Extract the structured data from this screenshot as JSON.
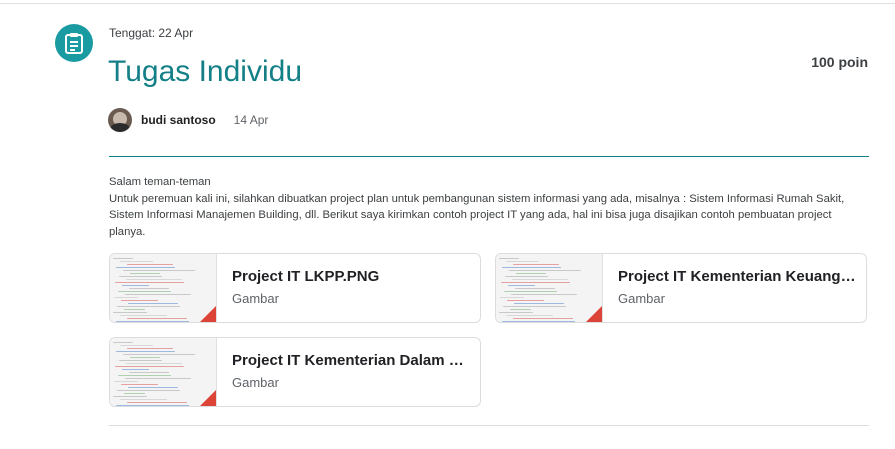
{
  "assignment": {
    "due": "Tenggat: 22 Apr",
    "title": "Tugas Individu",
    "points": "100 poin",
    "author": "budi santoso",
    "date": "14 Apr",
    "description": [
      "Salam teman-teman",
      "Untuk peremuan kali ini, silahkan dibuatkan project plan untuk pembangunan sistem informasi yang ada, misalnya : Sistem Informasi Rumah Sakit, Sistem Informasi Manajemen Building, dll. Berikut saya kirimkan contoh project IT yang ada, hal ini bisa juga disajikan contoh pembuatan project planya."
    ]
  },
  "attachments": [
    {
      "name": "Project IT LKPP.PNG",
      "type": "Gambar"
    },
    {
      "name": "Project IT Kementerian Keuangan.PNG",
      "type": "Gambar"
    },
    {
      "name": "Project IT Kementerian Dalam Negeri.PNG",
      "type": "Gambar"
    }
  ],
  "colors": {
    "accent": "#137f86",
    "icon_bg": "#1a9ba1",
    "fold": "#db4437"
  },
  "icons": {
    "assignment": "assignment-icon"
  }
}
